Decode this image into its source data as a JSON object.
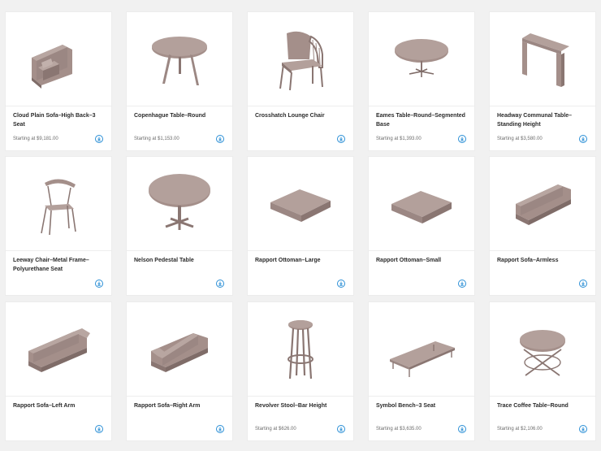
{
  "products": [
    {
      "name": "Cloud Plain Sofa–High Back–3 Seat",
      "price": "Starting at $9,181.00",
      "icon": "sofa-high-back-icon"
    },
    {
      "name": "Copenhague Table–Round",
      "price": "Starting at $1,153.00",
      "icon": "round-table-icon"
    },
    {
      "name": "Crosshatch Lounge Chair",
      "price": "",
      "icon": "lounge-chair-icon"
    },
    {
      "name": "Eames Table–Round–Segmented Base",
      "price": "Starting at $1,393.00",
      "icon": "segmented-base-table-icon"
    },
    {
      "name": "Headway Communal Table–Standing Height",
      "price": "Starting at $3,580.00",
      "icon": "standing-table-icon"
    },
    {
      "name": "Leeway Chair–Metal Frame–Polyurethane Seat",
      "price": "",
      "icon": "metal-chair-icon"
    },
    {
      "name": "Nelson Pedestal Table",
      "price": "",
      "icon": "pedestal-table-icon"
    },
    {
      "name": "Rapport Ottoman–Large",
      "price": "",
      "icon": "ottoman-large-icon"
    },
    {
      "name": "Rapport Ottoman–Small",
      "price": "",
      "icon": "ottoman-small-icon"
    },
    {
      "name": "Rapport Sofa–Armless",
      "price": "",
      "icon": "sofa-armless-icon"
    },
    {
      "name": "Rapport Sofa–Left Arm",
      "price": "",
      "icon": "sofa-left-arm-icon"
    },
    {
      "name": "Rapport Sofa–Right Arm",
      "price": "",
      "icon": "sofa-right-arm-icon"
    },
    {
      "name": "Revolver Stool–Bar Height",
      "price": "Starting at $626.00",
      "icon": "bar-stool-icon"
    },
    {
      "name": "Symbol Bench–3 Seat",
      "price": "Starting at $3,635.00",
      "icon": "bench-icon"
    },
    {
      "name": "Trace Coffee Table–Round",
      "price": "Starting at $2,106.00",
      "icon": "coffee-table-icon"
    }
  ],
  "download_icon": "download-icon",
  "colors": {
    "accent": "#2b8fd6",
    "furniture": "#a48f8a",
    "furniture_dark": "#8a7672",
    "furniture_light": "#b8a6a1"
  }
}
